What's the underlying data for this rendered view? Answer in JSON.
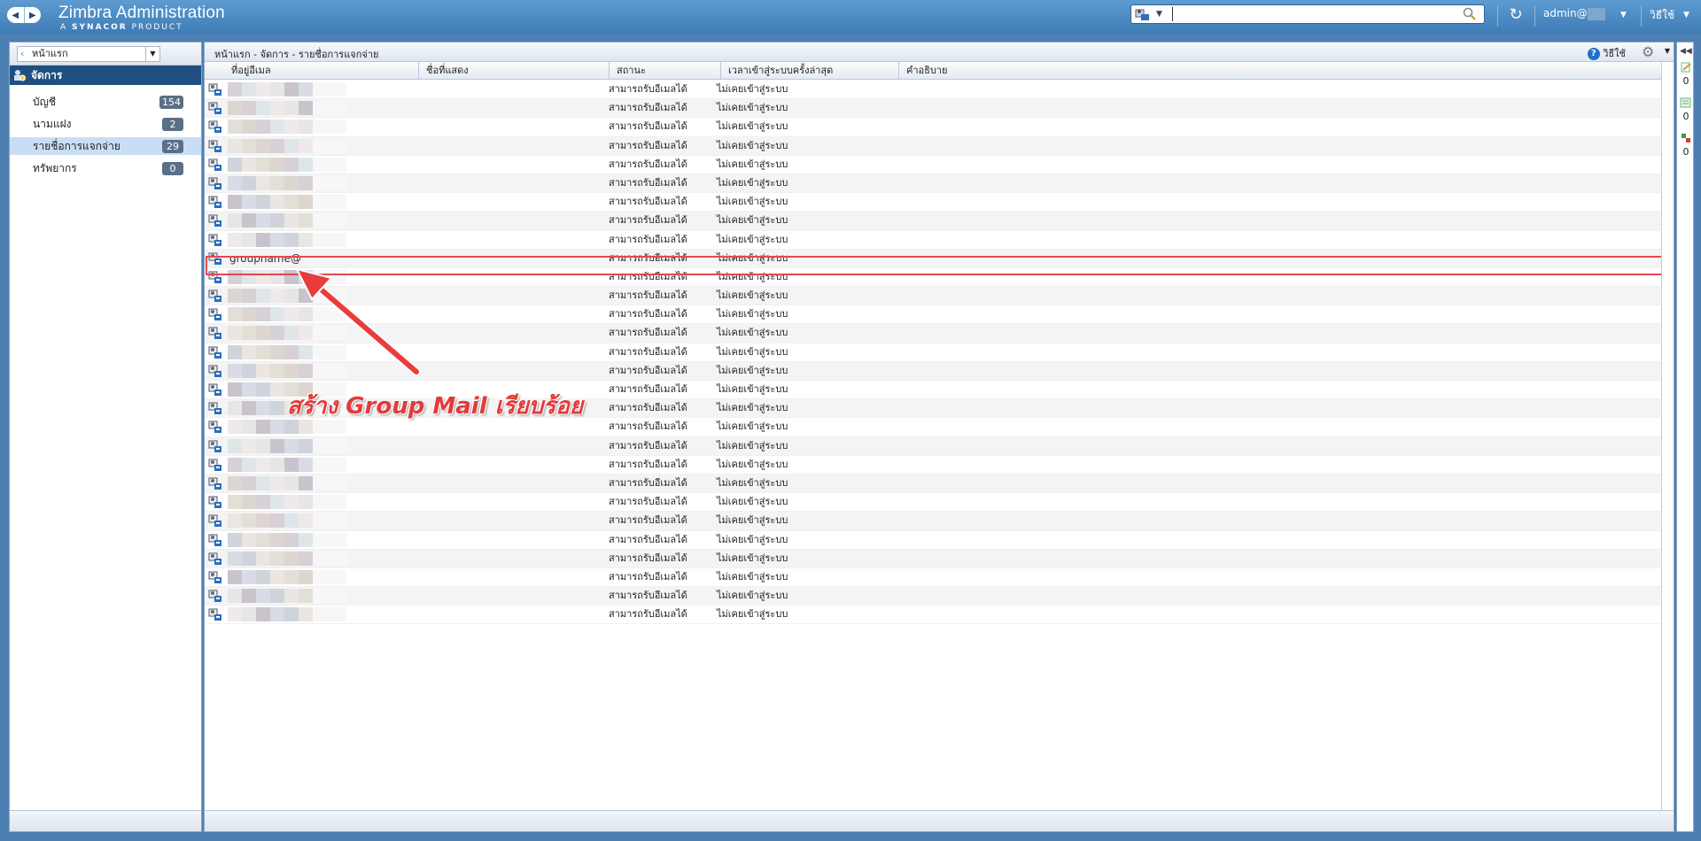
{
  "app": {
    "title": "Zimbra Administration",
    "subtitle_prefix": "A",
    "subtitle_brand": "SYNACOR",
    "subtitle_suffix": "PRODUCT"
  },
  "header": {
    "search_value": "",
    "user_label": "admin@",
    "help_label": "วิธีใช้"
  },
  "left_panel": {
    "breadcrumb_select": "หน้าแรก",
    "section_title": "จัดการ",
    "items": [
      {
        "label": "บัญชี",
        "count": "154"
      },
      {
        "label": "นามแฝง",
        "count": "2"
      },
      {
        "label": "รายชื่อการแจกจ่าย",
        "count": "29"
      },
      {
        "label": "ทรัพยากร",
        "count": "0"
      }
    ]
  },
  "main_panel": {
    "breadcrumb": "หน้าแรก - จัดการ - รายชื่อการแจกจ่าย",
    "help_label": "วิธีใช้",
    "columns": [
      "ที่อยู่อีเมล",
      "ชื่อที่แสดง",
      "สถานะ",
      "เวลาเข้าสู่ระบบครั้งล่าสุด",
      "คำอธิบาย"
    ],
    "row_status": "สามารถรับอีเมลได้",
    "row_last_login": "ไม่เคยเข้าสู่ระบบ",
    "highlighted_address": "groupname@",
    "row_count": 29,
    "highlighted_row_index": 9
  },
  "right_strip": {
    "counts": [
      "0",
      "0",
      "0"
    ]
  },
  "annotation": {
    "text": "สร้าง Group Mail เรียบร้อย",
    "color": "#e43a3a"
  },
  "colors": {
    "topbar": "#4a89c4",
    "selected_item": "#c9def4",
    "manage_header": "#1f4f80",
    "highlight_border": "#e5484d"
  }
}
